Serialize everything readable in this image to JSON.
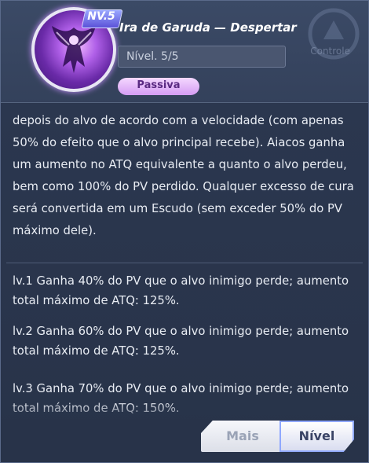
{
  "header": {
    "level_badge": "NV.5",
    "title": "Ira de Garuda — Despertar",
    "level_field": "Nível. 5/5",
    "tag": "Passiva",
    "background_label": "Controle"
  },
  "description": "depois do alvo de acordo com a velocidade (com apenas 50% do efeito que o alvo principal recebe). Aiacos ganha um aumento no ATQ equivalente a quanto o alvo perdeu, bem como 100% do PV perdido. Qualquer excesso de cura será convertida em um Escudo (sem exceder 50% do PV máximo dele).",
  "levels": [
    {
      "label": "lv.1 Ganha 40% do PV que o alvo inimigo perde; aumento total máximo de ATQ: 125%."
    },
    {
      "label": "lv.2 Ganha 60% do PV que o alvo inimigo perde; aumento total máximo de ATQ: 125%."
    },
    {
      "label": "lv.3 Ganha 70% do PV que o alvo inimigo perde; aumento total máximo de ATQ: 150%."
    }
  ],
  "buttons": {
    "more": "Mais",
    "level": "Nível"
  },
  "colors": {
    "panel": "#33405a",
    "tag": "#d59cf3",
    "accent": "#8fa8ff"
  },
  "icons": {
    "avatar": "garuda-portrait-icon",
    "background": "control-icon"
  }
}
